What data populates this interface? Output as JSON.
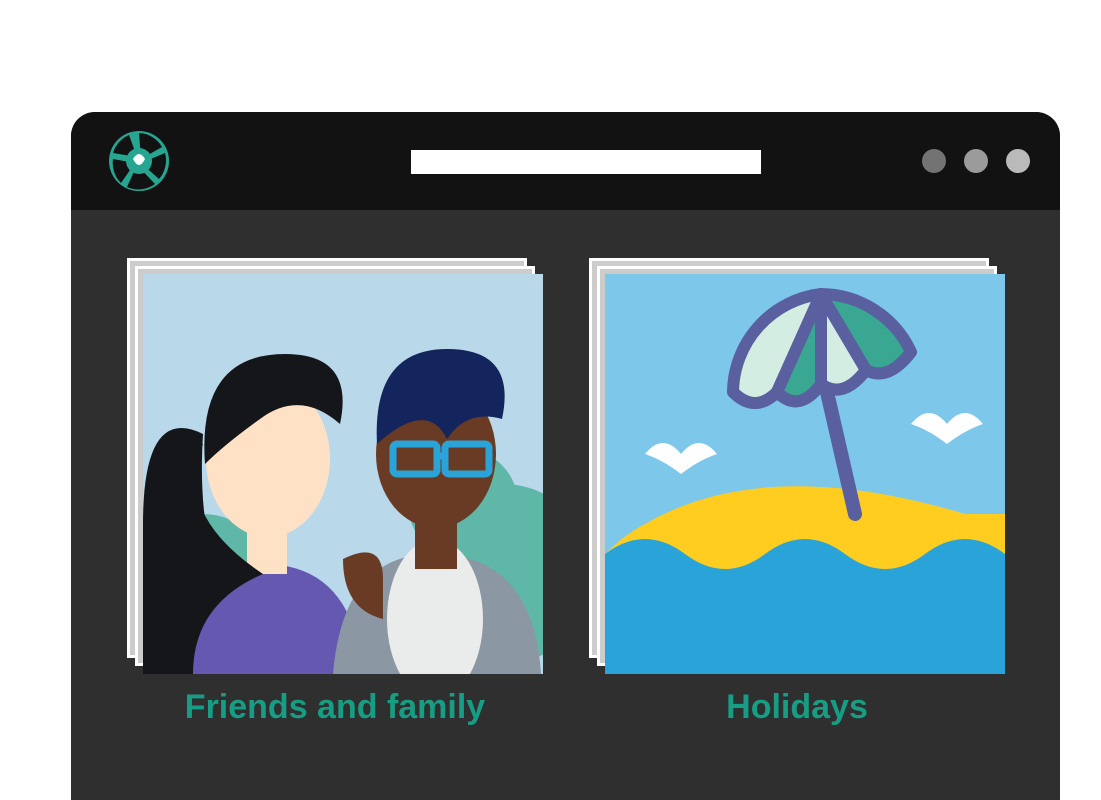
{
  "app": {
    "logo_name": "aperture-logo"
  },
  "search": {
    "value": "",
    "placeholder": ""
  },
  "albums": [
    {
      "label": "Friends and family",
      "cover": "people-illustration"
    },
    {
      "label": "Holidays",
      "cover": "beach-illustration"
    }
  ],
  "colors": {
    "accent": "#179d84",
    "window_bg": "#2f2f2f",
    "titlebar_bg": "#121212"
  }
}
